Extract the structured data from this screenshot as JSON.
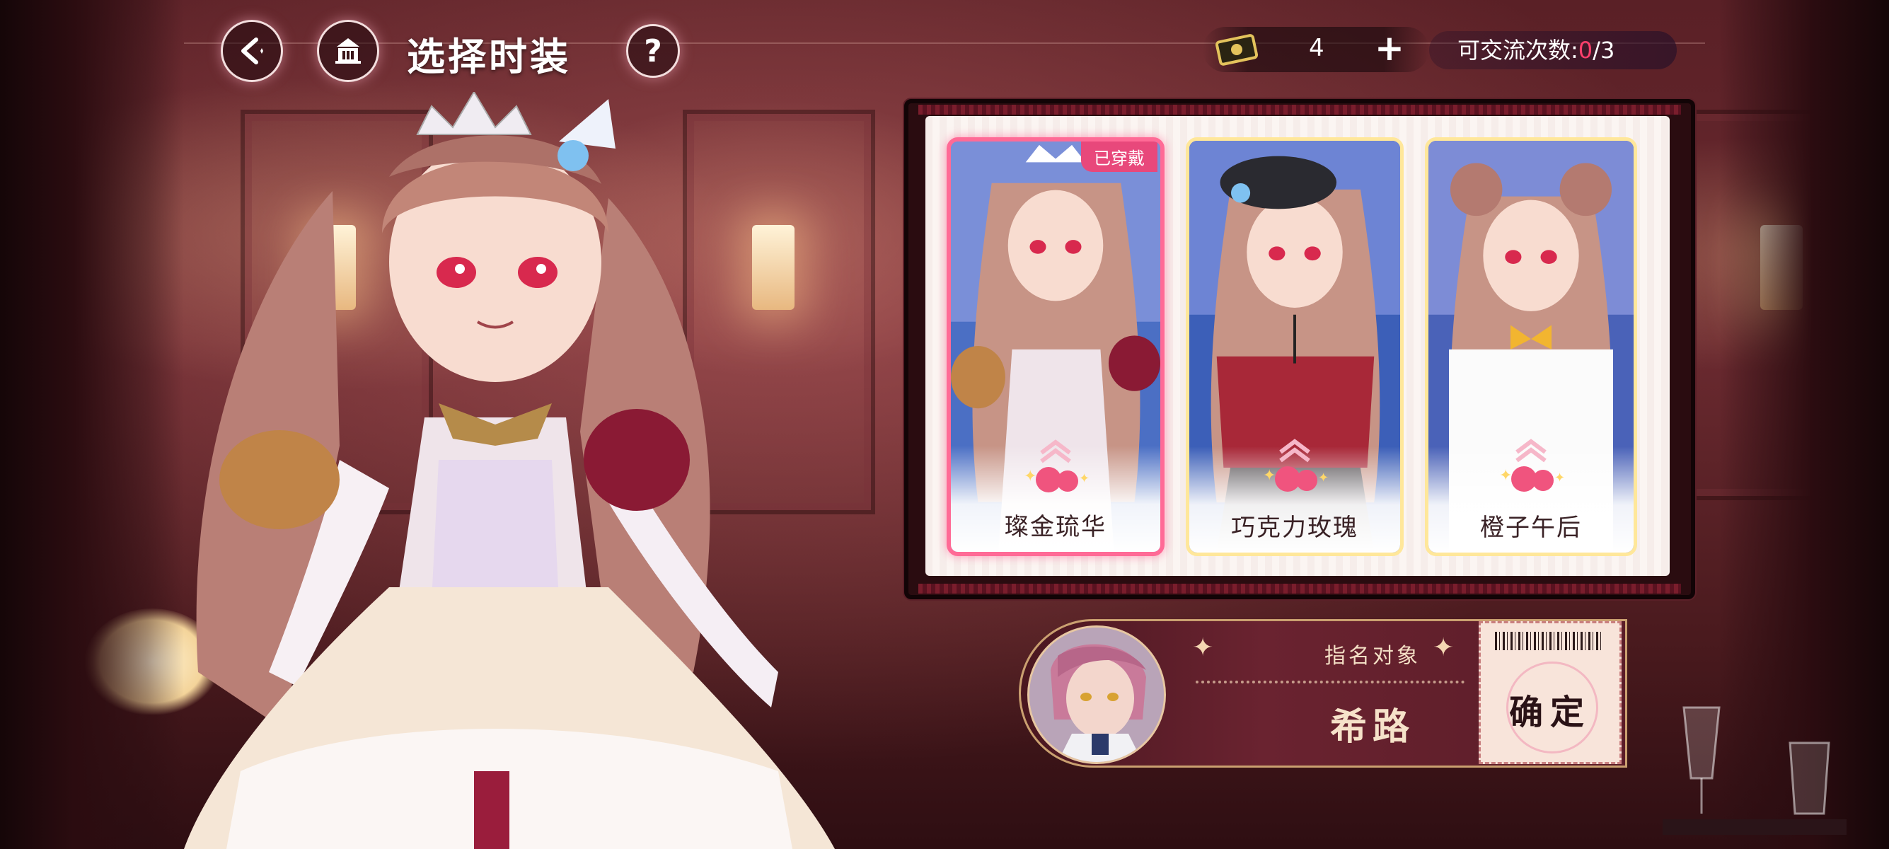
{
  "header": {
    "title": "选择时装",
    "back_icon": "back-arrow-icon",
    "home_icon": "building-icon",
    "help_label": "?"
  },
  "currency": {
    "icon": "ticket-icon",
    "value": "4",
    "add_label": "+"
  },
  "exchange": {
    "label": "可交流次数:",
    "used": "0",
    "total": "/3",
    "used_color": "#ff3f6c"
  },
  "outfits": [
    {
      "name": "璨金琉华",
      "badge": "已穿戴",
      "selected": true
    },
    {
      "name": "巧克力玫瑰"
    },
    {
      "name": "橙子午后"
    }
  ],
  "nominate": {
    "label": "指名对象",
    "name": "希路",
    "confirm_label": "确定"
  },
  "colors": {
    "accent_pink": "#e8487b",
    "card_border": "#ffe79a",
    "panel": "#6a2330"
  }
}
